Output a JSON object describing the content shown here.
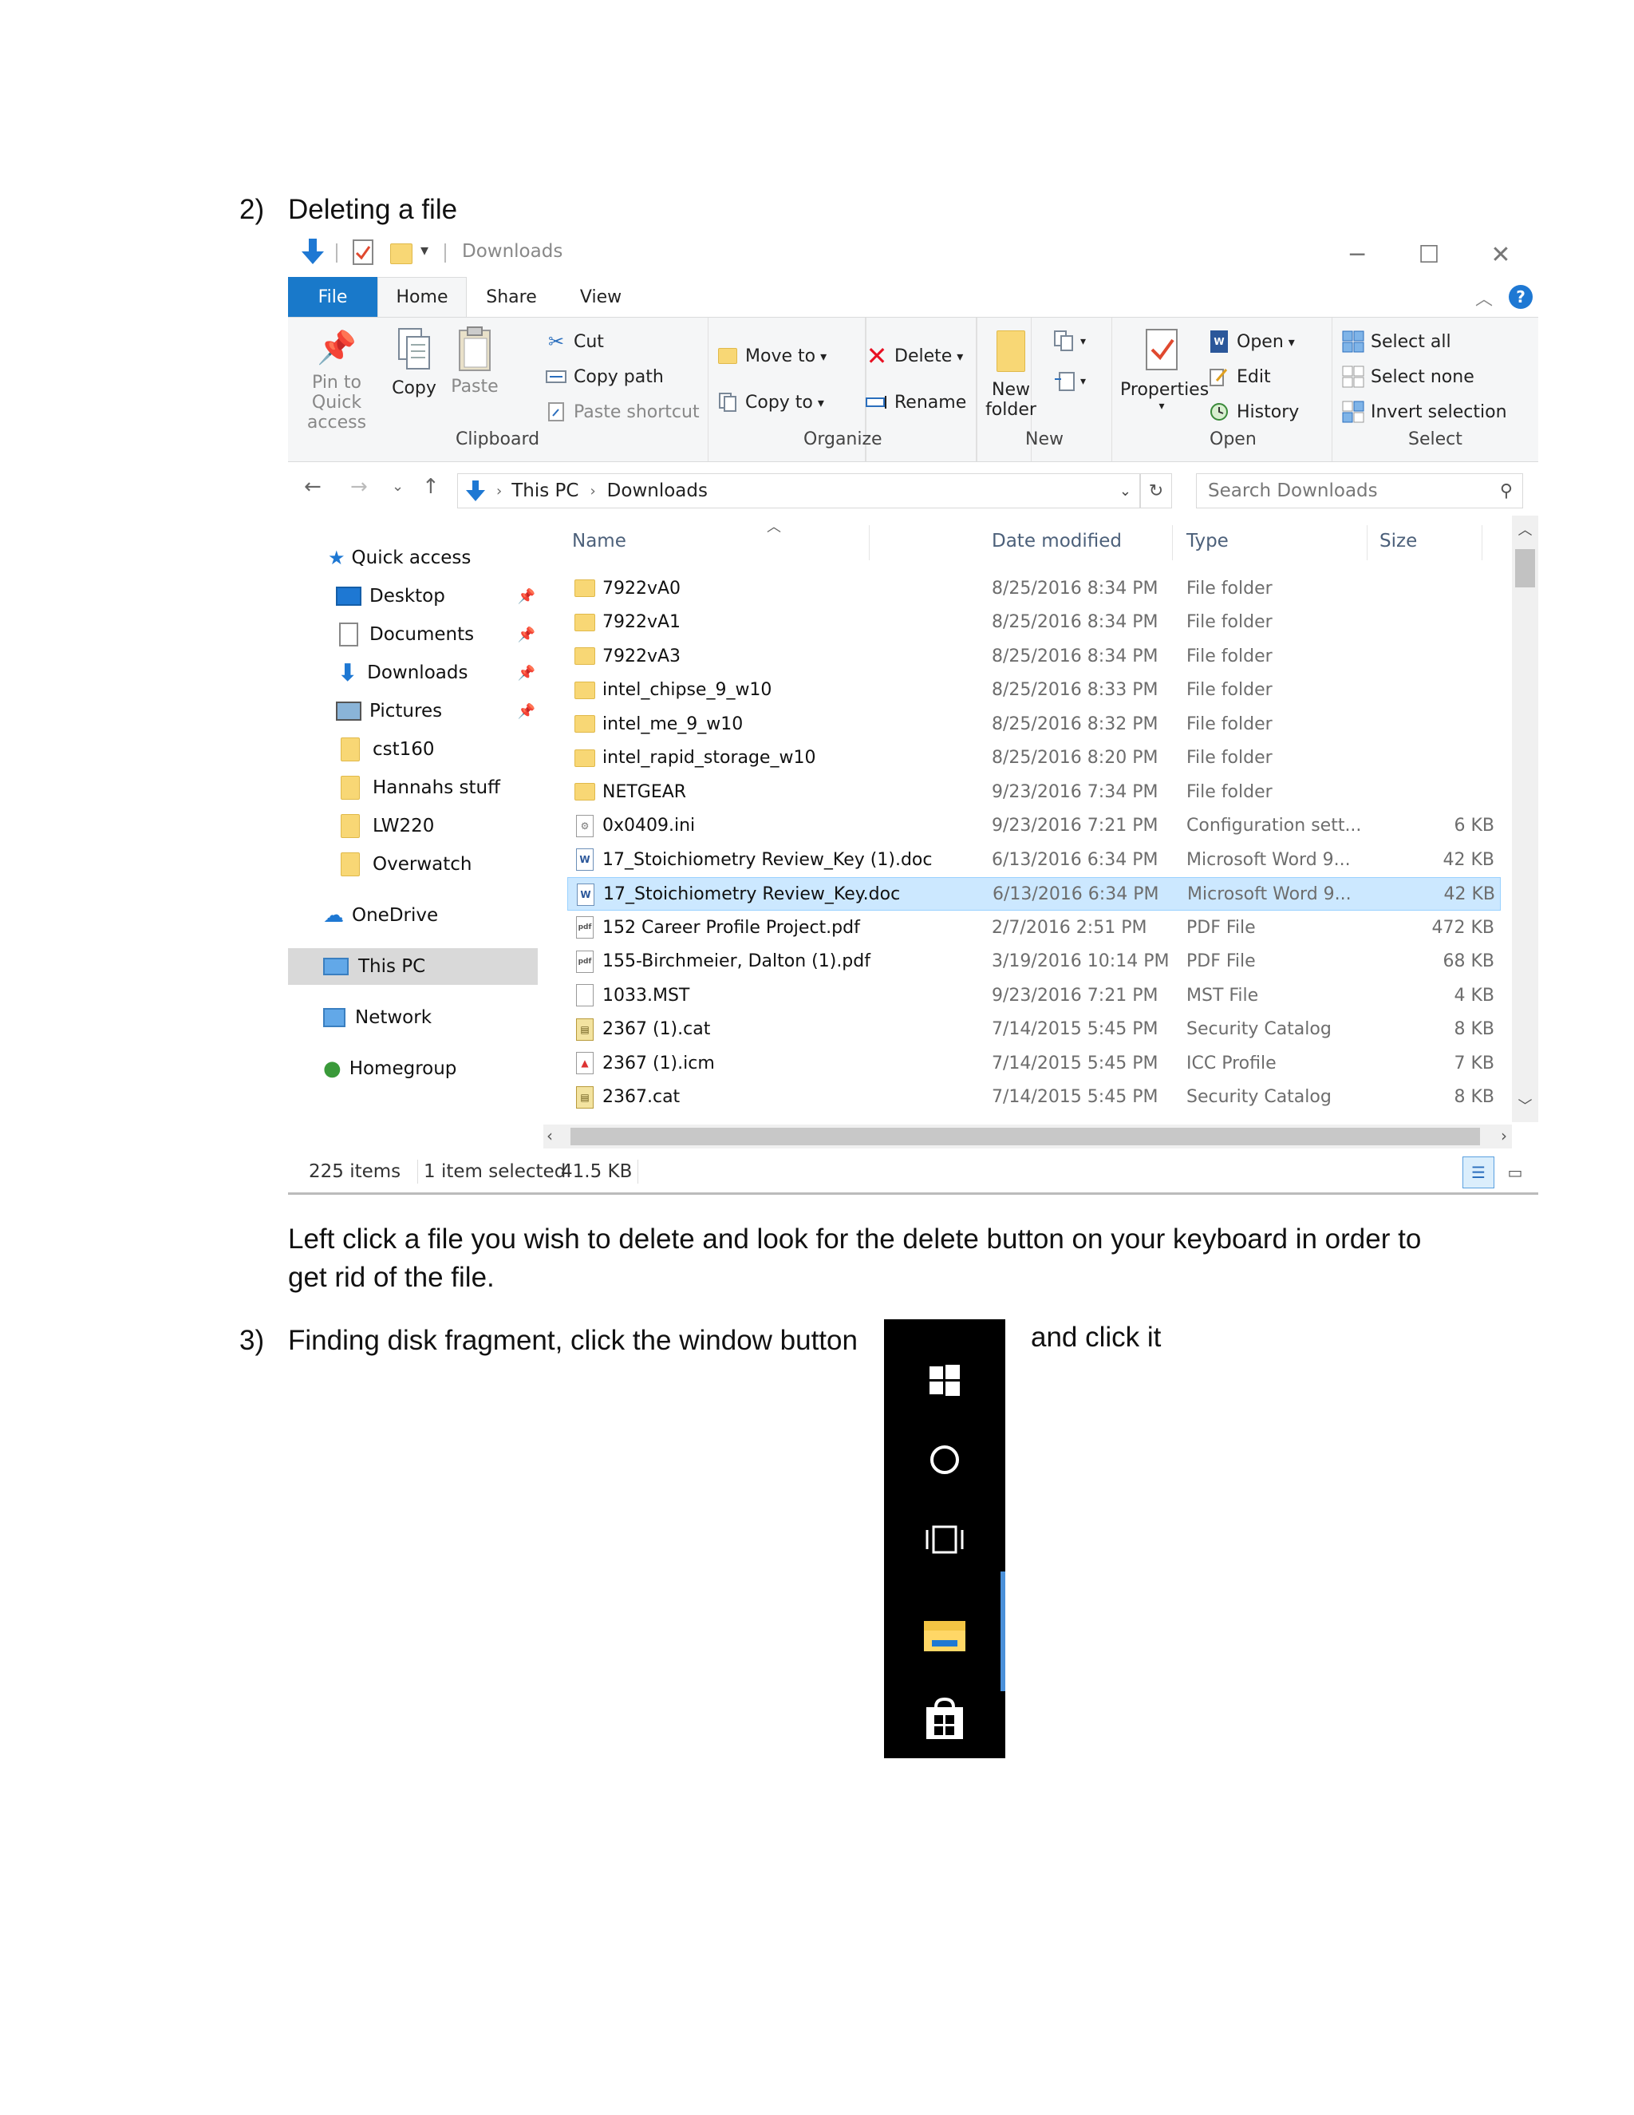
{
  "doc": {
    "step2_number": "2)",
    "step2_title": "Deleting a file",
    "step2_body_line1": "Left click a file you wish to delete and look for the delete button on your keyboard in order to",
    "step2_body_line2": "get rid of the file.",
    "step3_number": "3)",
    "step3_text": "Finding disk fragment, click the window button",
    "step3_after": "and click it"
  },
  "explorer": {
    "title": "Downloads",
    "tabs": [
      "File",
      "Home",
      "Share",
      "View"
    ],
    "ribbon": {
      "clipboard": {
        "pin": "Pin to Quick",
        "pin2": "access",
        "copy": "Copy",
        "paste": "Paste",
        "cut": "Cut",
        "copy_path": "Copy path",
        "paste_shortcut": "Paste shortcut",
        "label": "Clipboard"
      },
      "organize": {
        "move_to": "Move to",
        "copy_to": "Copy to",
        "delete": "Delete",
        "rename": "Rename",
        "label": "Organize"
      },
      "new": {
        "new_folder1": "New",
        "new_folder2": "folder",
        "label": "New"
      },
      "open": {
        "properties": "Properties",
        "open": "Open",
        "edit": "Edit",
        "history": "History",
        "label": "Open"
      },
      "select": {
        "select_all": "Select all",
        "select_none": "Select none",
        "invert": "Invert selection",
        "label": "Select"
      }
    },
    "address": {
      "crumb1": "This PC",
      "crumb2": "Downloads",
      "search_placeholder": "Search Downloads"
    },
    "nav": {
      "quick_access": "Quick access",
      "desktop": "Desktop",
      "documents": "Documents",
      "downloads": "Downloads",
      "pictures": "Pictures",
      "cst160": "cst160",
      "hannahs": "Hannahs stuff",
      "lw220": "LW220",
      "overwatch": "Overwatch",
      "onedrive": "OneDrive",
      "thispc": "This PC",
      "network": "Network",
      "homegroup": "Homegroup"
    },
    "columns": {
      "name": "Name",
      "date": "Date modified",
      "type": "Type",
      "size": "Size"
    },
    "files": [
      {
        "name": "7922vA0",
        "date": "8/25/2016 8:34 PM",
        "type": "File folder",
        "size": "",
        "icon": "folder"
      },
      {
        "name": "7922vA1",
        "date": "8/25/2016 8:34 PM",
        "type": "File folder",
        "size": "",
        "icon": "folder"
      },
      {
        "name": "7922vA3",
        "date": "8/25/2016 8:34 PM",
        "type": "File folder",
        "size": "",
        "icon": "folder"
      },
      {
        "name": "intel_chipse_9_w10",
        "date": "8/25/2016 8:33 PM",
        "type": "File folder",
        "size": "",
        "icon": "folder"
      },
      {
        "name": "intel_me_9_w10",
        "date": "8/25/2016 8:32 PM",
        "type": "File folder",
        "size": "",
        "icon": "folder"
      },
      {
        "name": "intel_rapid_storage_w10",
        "date": "8/25/2016 8:20 PM",
        "type": "File folder",
        "size": "",
        "icon": "folder"
      },
      {
        "name": "NETGEAR",
        "date": "9/23/2016 7:34 PM",
        "type": "File folder",
        "size": "",
        "icon": "folder"
      },
      {
        "name": "0x0409.ini",
        "date": "9/23/2016 7:21 PM",
        "type": "Configuration sett...",
        "size": "6 KB",
        "icon": "ini"
      },
      {
        "name": "17_Stoichiometry Review_Key (1).doc",
        "date": "6/13/2016 6:34 PM",
        "type": "Microsoft Word 9...",
        "size": "42 KB",
        "icon": "word"
      },
      {
        "name": "17_Stoichiometry Review_Key.doc",
        "date": "6/13/2016 6:34 PM",
        "type": "Microsoft Word 9...",
        "size": "42 KB",
        "icon": "word",
        "selected": true
      },
      {
        "name": "152 Career Profile Project.pdf",
        "date": "2/7/2016 2:51 PM",
        "type": "PDF File",
        "size": "472 KB",
        "icon": "pdf"
      },
      {
        "name": "155-Birchmeier, Dalton (1).pdf",
        "date": "3/19/2016 10:14 PM",
        "type": "PDF File",
        "size": "68 KB",
        "icon": "pdf"
      },
      {
        "name": "1033.MST",
        "date": "9/23/2016 7:21 PM",
        "type": "MST File",
        "size": "4 KB",
        "icon": "blank"
      },
      {
        "name": "2367 (1).cat",
        "date": "7/14/2015 5:45 PM",
        "type": "Security Catalog",
        "size": "8 KB",
        "icon": "cat"
      },
      {
        "name": "2367 (1).icm",
        "date": "7/14/2015 5:45 PM",
        "type": "ICC Profile",
        "size": "7 KB",
        "icon": "icm"
      },
      {
        "name": "2367.cat",
        "date": "7/14/2015 5:45 PM",
        "type": "Security Catalog",
        "size": "8 KB",
        "icon": "cat"
      }
    ],
    "status": {
      "count": "225 items",
      "selected": "1 item selected",
      "size": "41.5 KB"
    },
    "colors": {
      "accent": "#1979ca",
      "selection": "#cce8ff",
      "folder": "#f8d775"
    }
  }
}
